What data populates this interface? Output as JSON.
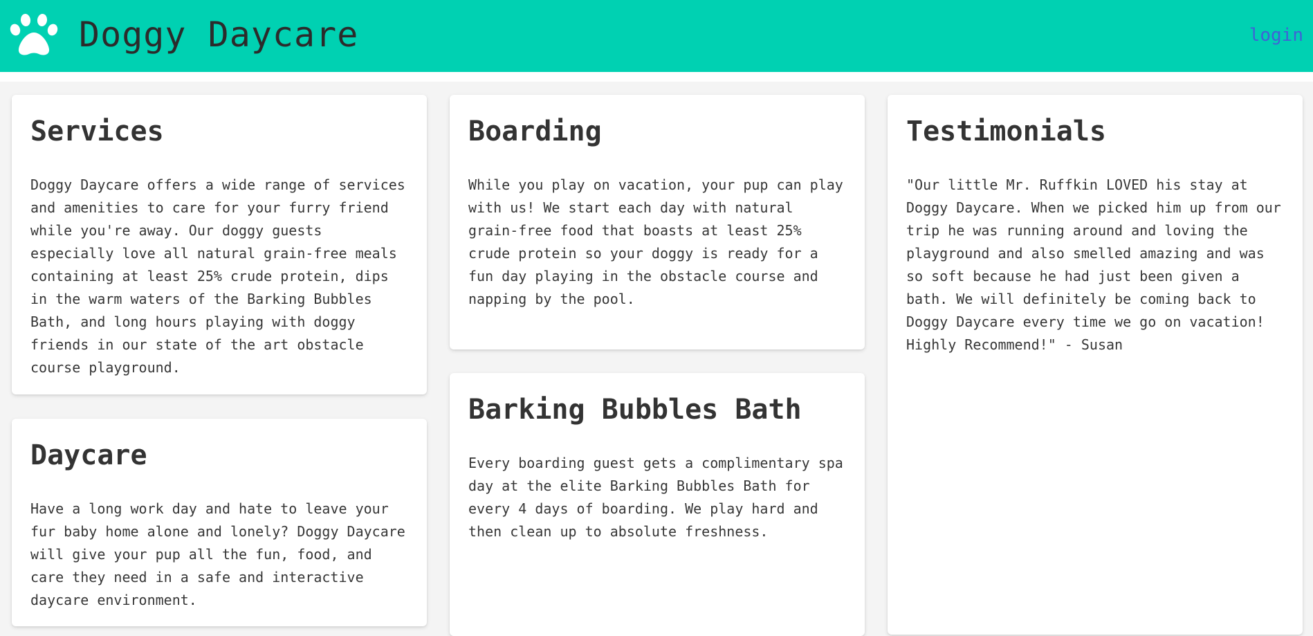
{
  "header": {
    "logo_icon": "paw-print-icon",
    "title": "Doggy Daycare",
    "login_label": "login",
    "background_color": "#00d1b2",
    "link_color": "#3f63d6"
  },
  "cards": {
    "services": {
      "title": "Services",
      "body": "Doggy Daycare offers a wide range of services and amenities to care for your furry friend while you're away. Our doggy guests especially love all natural grain-free meals containing at least 25% crude protein, dips in the warm waters of the Barking Bubbles Bath, and long hours playing with doggy friends in our state of the art obstacle course playground."
    },
    "daycare": {
      "title": "Daycare",
      "body": "Have a long work day and hate to leave your fur baby home alone and lonely? Doggy Daycare will give your pup all the fun, food, and care they need in a safe and interactive daycare environment."
    },
    "boarding": {
      "title": "Boarding",
      "body": "While you play on vacation, your pup can play with us! We start each day with natural grain-free food that boasts at least 25% crude protein so your doggy is ready for a fun day playing in the obstacle course and napping by the pool."
    },
    "bath": {
      "title": "Barking Bubbles Bath",
      "body": "Every boarding guest gets a complimentary spa day at the elite Barking Bubbles Bath for every 4 days of boarding. We play hard and then clean up to absolute freshness."
    },
    "testimonials": {
      "title": "Testimonials",
      "body": "\"Our little Mr. Ruffkin LOVED his stay at Doggy Daycare. When we picked him up from our trip he was running around and loving the playground and also smelled amazing and was so soft because he had just been given a bath. We will definitely be coming back to Doggy Daycare every time we go on vacation! Highly Recommend!\" - Susan"
    }
  }
}
